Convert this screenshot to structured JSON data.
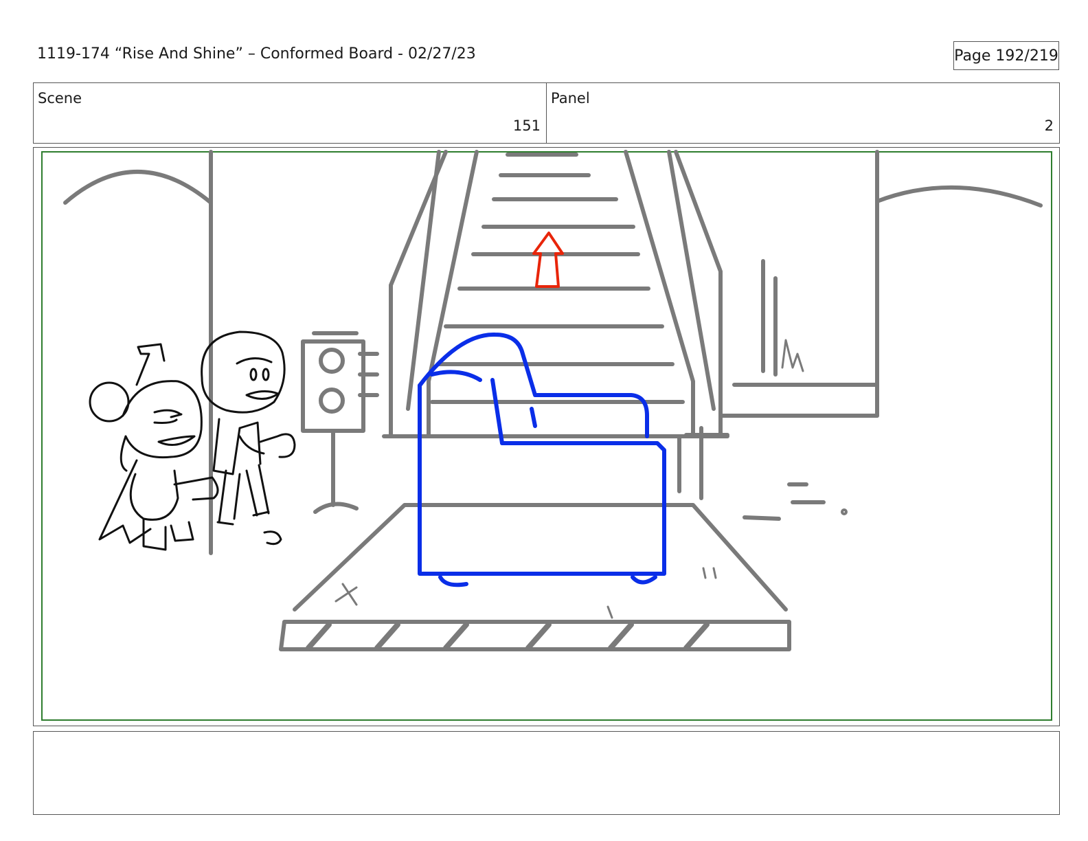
{
  "header": {
    "title": "1119-174 “Rise And Shine” – Conformed Board - 02/27/23",
    "page": "Page 192/219"
  },
  "info": {
    "scene_label": "Scene",
    "scene_value": "151",
    "panel_label": "Panel",
    "panel_value": "2"
  },
  "drawing": {
    "sketch_color": "#7a7a7a",
    "couch_color": "#0a2ee8",
    "arrow_color": "#e8250a",
    "safe_frame_color": "#2e7d2e",
    "character_color": "#111111"
  },
  "notes": {
    "text": ""
  }
}
